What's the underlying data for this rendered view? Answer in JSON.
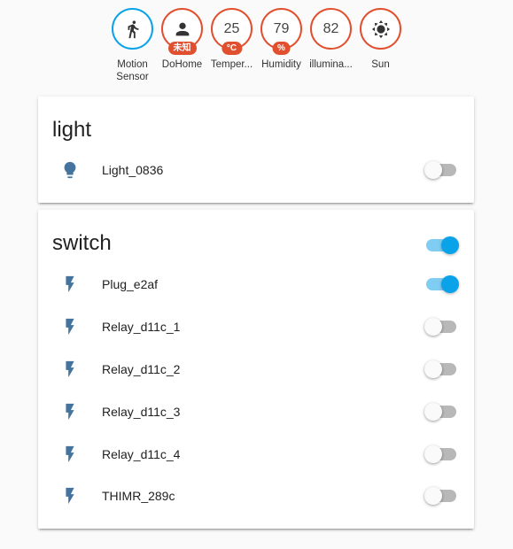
{
  "badges": [
    {
      "label": "Motion Sensor",
      "icon": "walk-icon",
      "ring": "blue"
    },
    {
      "label": "DoHome",
      "icon": "person-icon",
      "chip": "未知"
    },
    {
      "label": "Temper...",
      "value": "25",
      "chip": "°C"
    },
    {
      "label": "Humidity",
      "value": "79",
      "chip": "%"
    },
    {
      "label": "illumina...",
      "value": "82"
    },
    {
      "label": "Sun",
      "icon": "sun-icon"
    }
  ],
  "light_card": {
    "title": "light",
    "entities": [
      {
        "name": "Light_0836",
        "icon": "bulb-icon",
        "state": "off"
      }
    ]
  },
  "switch_card": {
    "title": "switch",
    "group_state": "on",
    "entities": [
      {
        "name": "Plug_e2af",
        "icon": "flash-icon",
        "state": "on"
      },
      {
        "name": "Relay_d11c_1",
        "icon": "flash-icon",
        "state": "off"
      },
      {
        "name": "Relay_d11c_2",
        "icon": "flash-icon",
        "state": "off"
      },
      {
        "name": "Relay_d11c_3",
        "icon": "flash-icon",
        "state": "off"
      },
      {
        "name": "Relay_d11c_4",
        "icon": "flash-icon",
        "state": "off"
      },
      {
        "name": "THIMR_289c",
        "icon": "flash-icon",
        "state": "off"
      }
    ]
  },
  "colors": {
    "badge_ring": "#e0502e",
    "badge_ring_active": "#0aa2e8",
    "icon": "#44739e",
    "toggle_on": "#0aa2e8"
  }
}
